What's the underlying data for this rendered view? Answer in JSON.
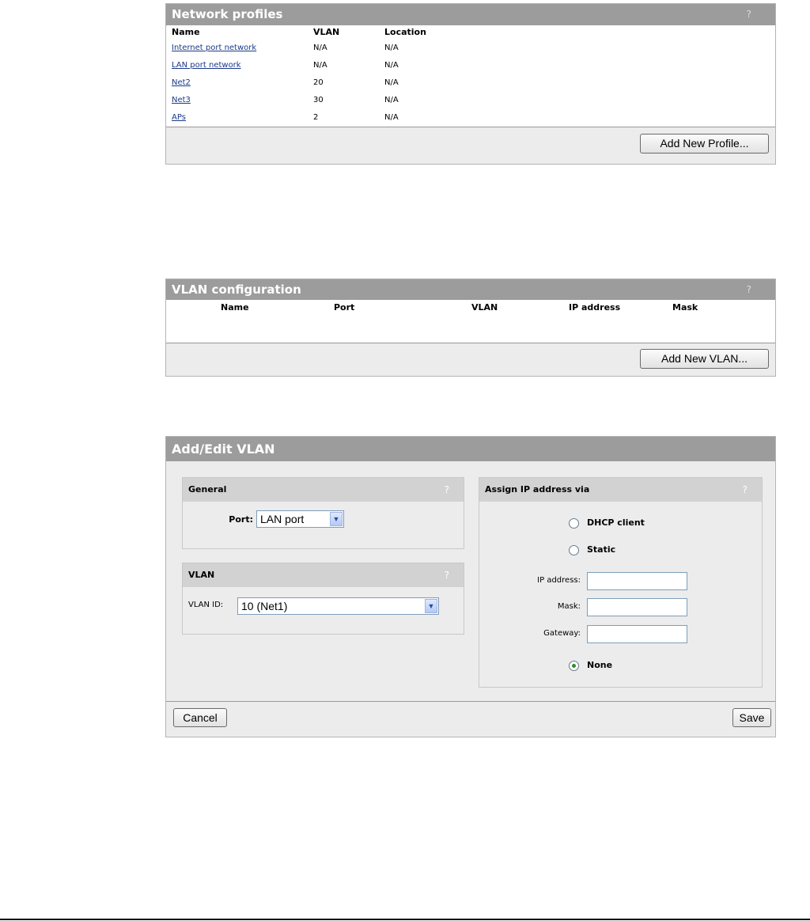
{
  "network_profiles": {
    "title": "Network profiles",
    "help": "?",
    "columns": [
      "Name",
      "VLAN",
      "Location"
    ],
    "rows": [
      {
        "name": "Internet port network",
        "vlan": "N/A",
        "location": "N/A"
      },
      {
        "name": "LAN port network",
        "vlan": "N/A",
        "location": "N/A"
      },
      {
        "name": "Net2",
        "vlan": "20",
        "location": "N/A"
      },
      {
        "name": "Net3",
        "vlan": "30",
        "location": "N/A"
      },
      {
        "name": "APs",
        "vlan": "2",
        "location": "N/A"
      }
    ],
    "add_button": "Add New Profile..."
  },
  "vlan_config": {
    "title": "VLAN configuration",
    "help": "?",
    "columns": [
      "Name",
      "Port",
      "VLAN",
      "IP address",
      "Mask"
    ],
    "add_button": "Add New VLAN..."
  },
  "add_edit": {
    "title": "Add/Edit VLAN",
    "general": {
      "title": "General",
      "help": "?",
      "port_label": "Port:",
      "port_value": "LAN port"
    },
    "vlan": {
      "title": "VLAN",
      "help": "?",
      "id_label": "VLAN ID:",
      "id_value": "10 (Net1)"
    },
    "assign": {
      "title": "Assign IP address via",
      "help": "?",
      "dhcp": "DHCP client",
      "static": "Static",
      "ip_label": "IP address:",
      "mask_label": "Mask:",
      "gateway_label": "Gateway:",
      "none": "None",
      "selected": "None"
    },
    "cancel": "Cancel",
    "save": "Save"
  }
}
